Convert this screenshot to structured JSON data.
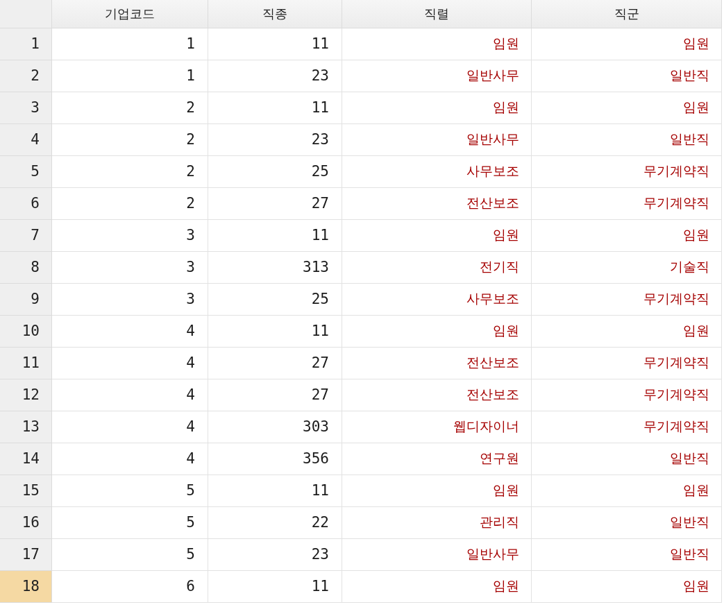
{
  "table": {
    "columns": [
      {
        "label": "기업코드",
        "kind": "number"
      },
      {
        "label": "직종",
        "kind": "number"
      },
      {
        "label": "직렬",
        "kind": "label"
      },
      {
        "label": "직군",
        "kind": "label"
      }
    ],
    "rows": [
      {
        "number": "1",
        "selected": false,
        "cells": [
          "1",
          "11",
          "임원",
          "임원"
        ]
      },
      {
        "number": "2",
        "selected": false,
        "cells": [
          "1",
          "23",
          "일반사무",
          "일반직"
        ]
      },
      {
        "number": "3",
        "selected": false,
        "cells": [
          "2",
          "11",
          "임원",
          "임원"
        ]
      },
      {
        "number": "4",
        "selected": false,
        "cells": [
          "2",
          "23",
          "일반사무",
          "일반직"
        ]
      },
      {
        "number": "5",
        "selected": false,
        "cells": [
          "2",
          "25",
          "사무보조",
          "무기계약직"
        ]
      },
      {
        "number": "6",
        "selected": false,
        "cells": [
          "2",
          "27",
          "전산보조",
          "무기계약직"
        ]
      },
      {
        "number": "7",
        "selected": false,
        "cells": [
          "3",
          "11",
          "임원",
          "임원"
        ]
      },
      {
        "number": "8",
        "selected": false,
        "cells": [
          "3",
          "313",
          "전기직",
          "기술직"
        ]
      },
      {
        "number": "9",
        "selected": false,
        "cells": [
          "3",
          "25",
          "사무보조",
          "무기계약직"
        ]
      },
      {
        "number": "10",
        "selected": false,
        "cells": [
          "4",
          "11",
          "임원",
          "임원"
        ]
      },
      {
        "number": "11",
        "selected": false,
        "cells": [
          "4",
          "27",
          "전산보조",
          "무기계약직"
        ]
      },
      {
        "number": "12",
        "selected": false,
        "cells": [
          "4",
          "27",
          "전산보조",
          "무기계약직"
        ]
      },
      {
        "number": "13",
        "selected": false,
        "cells": [
          "4",
          "303",
          "웹디자이너",
          "무기계약직"
        ]
      },
      {
        "number": "14",
        "selected": false,
        "cells": [
          "4",
          "356",
          "연구원",
          "일반직"
        ]
      },
      {
        "number": "15",
        "selected": false,
        "cells": [
          "5",
          "11",
          "임원",
          "임원"
        ]
      },
      {
        "number": "16",
        "selected": false,
        "cells": [
          "5",
          "22",
          "관리직",
          "일반직"
        ]
      },
      {
        "number": "17",
        "selected": false,
        "cells": [
          "5",
          "23",
          "일반사무",
          "일반직"
        ]
      },
      {
        "number": "18",
        "selected": true,
        "cells": [
          "6",
          "11",
          "임원",
          "임원"
        ]
      }
    ]
  }
}
